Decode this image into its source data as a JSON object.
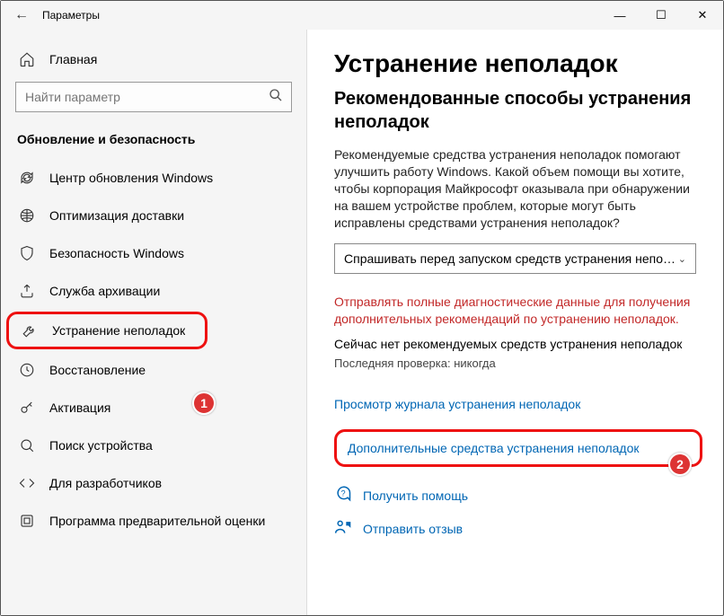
{
  "window": {
    "title": "Параметры"
  },
  "sidebar": {
    "home": "Главная",
    "search_placeholder": "Найти параметр",
    "section": "Обновление и безопасность",
    "items": [
      {
        "label": "Центр обновления Windows"
      },
      {
        "label": "Оптимизация доставки"
      },
      {
        "label": "Безопасность Windows"
      },
      {
        "label": "Служба архивации"
      },
      {
        "label": "Устранение неполадок"
      },
      {
        "label": "Восстановление"
      },
      {
        "label": "Активация"
      },
      {
        "label": "Поиск устройства"
      },
      {
        "label": "Для разработчиков"
      },
      {
        "label": "Программа предварительной оценки"
      }
    ]
  },
  "main": {
    "heading": "Устранение неполадок",
    "subheading": "Рекомендованные способы устранения неполадок",
    "description": "Рекомендуемые средства устранения неполадок помогают улучшить работу Windows. Какой объем помощи вы хотите, чтобы корпорация Майкрософт оказывала при обнаружении на вашем устройстве проблем, которые могут быть исправлены средствами устранения неполадок?",
    "dropdown_value": "Спрашивать перед запуском средств устранения непо…",
    "warning": "Отправлять полные диагностические данные для получения дополнительных рекомендаций по устранению неполадок.",
    "status": "Сейчас нет рекомендуемых средств устранения неполадок",
    "last_check": "Последняя проверка: никогда",
    "link_history": "Просмотр журнала устранения неполадок",
    "link_additional": "Дополнительные средства устранения неполадок",
    "help": "Получить помощь",
    "feedback": "Отправить отзыв"
  },
  "badges": {
    "b1": "1",
    "b2": "2"
  }
}
